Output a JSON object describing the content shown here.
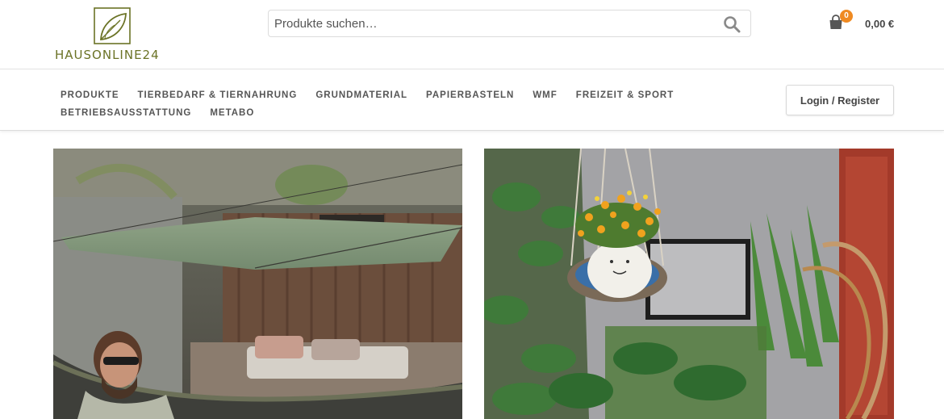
{
  "header": {
    "logo_text": "HAUSONLINE24",
    "search_placeholder": "Produkte suchen…",
    "cart_count": "0",
    "cart_total": "0,00 €"
  },
  "nav": {
    "row1": [
      "PRODUKTE",
      "TIERBEDARF & TIERNAHRUNG",
      "GRUNDMATERIAL",
      "PAPIERBASTELN",
      "WMF",
      "FREIZEIT & SPORT"
    ],
    "row2": [
      "BETRIEBSAUSSTATTUNG",
      "METABO"
    ],
    "login_label": "Login / Register"
  },
  "icons": {
    "logo": "leaf-logo-icon",
    "search": "search-icon",
    "cart": "shopping-bag-icon"
  },
  "colors": {
    "brand": "#6b7326",
    "badge": "#ef8a22"
  }
}
